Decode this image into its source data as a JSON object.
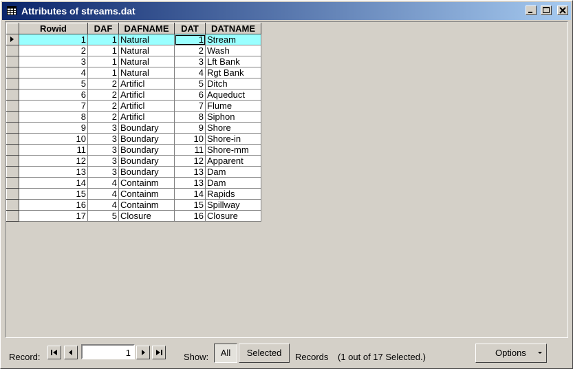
{
  "window": {
    "title": "Attributes of streams.dat"
  },
  "columns": [
    "Rowid",
    "DAF",
    "DAFNAME",
    "DAT",
    "DATNAME"
  ],
  "rows": [
    [
      "1",
      "1",
      "Natural",
      "1",
      "Stream"
    ],
    [
      "2",
      "1",
      "Natural",
      "2",
      "Wash"
    ],
    [
      "3",
      "1",
      "Natural",
      "3",
      "Lft Bank"
    ],
    [
      "4",
      "1",
      "Natural",
      "4",
      "Rgt Bank"
    ],
    [
      "5",
      "2",
      "Artificl",
      "5",
      "Ditch"
    ],
    [
      "6",
      "2",
      "Artificl",
      "6",
      "Aqueduct"
    ],
    [
      "7",
      "2",
      "Artificl",
      "7",
      "Flume"
    ],
    [
      "8",
      "2",
      "Artificl",
      "8",
      "Siphon"
    ],
    [
      "9",
      "3",
      "Boundary",
      "9",
      "Shore"
    ],
    [
      "10",
      "3",
      "Boundary",
      "10",
      "Shore-in"
    ],
    [
      "11",
      "3",
      "Boundary",
      "11",
      "Shore-mm"
    ],
    [
      "12",
      "3",
      "Boundary",
      "12",
      "Apparent"
    ],
    [
      "13",
      "3",
      "Boundary",
      "13",
      "Dam"
    ],
    [
      "14",
      "4",
      "Containm",
      "13",
      "Dam"
    ],
    [
      "15",
      "4",
      "Containm",
      "14",
      "Rapids"
    ],
    [
      "16",
      "4",
      "Containm",
      "15",
      "Spillway"
    ],
    [
      "17",
      "5",
      "Closure",
      "16",
      "Closure"
    ]
  ],
  "footer": {
    "record_label": "Record:",
    "record_value": "1",
    "show_label": "Show:",
    "all_label": "All",
    "selected_label": "Selected",
    "records_label": "Records",
    "status": "(1 out of 17 Selected.)",
    "options_label": "Options"
  },
  "colors": {
    "selection": "#99ffff",
    "title_start": "#0a246a",
    "title_end": "#a6caf0"
  }
}
